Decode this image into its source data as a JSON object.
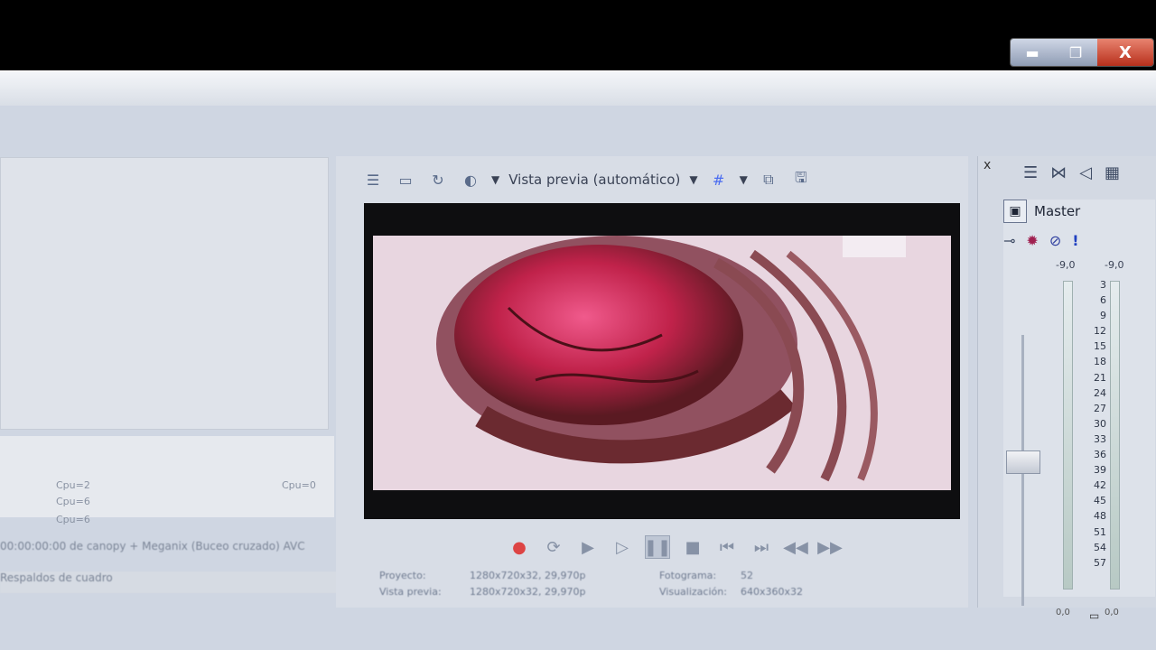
{
  "window": {
    "minimize_icon": "minimize-icon",
    "restore_icon": "restore-icon",
    "close_label": "X"
  },
  "left": {
    "list_items": [
      "Cpu=2",
      "Cpu=6",
      "Cpu=6",
      "Cpu=0"
    ],
    "status_line": "00:00:00:00 de canopy + Meganix (Buceo cruzado) AVC",
    "status_line2": "Respaldos de cuadro"
  },
  "preview": {
    "toolbar_label": "Vista previa (automático)",
    "info": {
      "project_label": "Proyecto:",
      "project_value": "1280x720x32, 29,970p",
      "preview_label": "Vista previa:",
      "preview_value": "1280x720x32, 29,970p",
      "frame_label": "Fotograma:",
      "frame_value": "52",
      "display_label": "Visualización:",
      "display_value": "640x360x32"
    }
  },
  "mixer": {
    "close": "x",
    "master_label": "Master",
    "peak_left": "-9,0",
    "peak_right": "-9,0",
    "scale": [
      "3",
      "6",
      "9",
      "12",
      "15",
      "18",
      "21",
      "24",
      "27",
      "30",
      "33",
      "36",
      "39",
      "42",
      "45",
      "48",
      "51",
      "54",
      "57"
    ],
    "bottom_left": "0,0",
    "bottom_right": "0,0"
  },
  "colors": {
    "accent": "#5a6b8a",
    "meter": "#b7c9c4",
    "record": "#d44"
  }
}
